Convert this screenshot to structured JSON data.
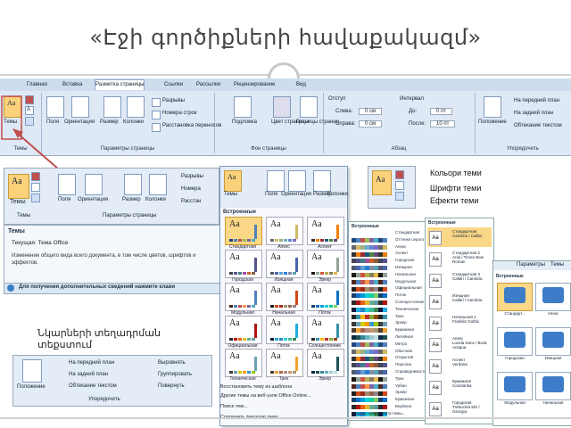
{
  "slide_title": "«Էջի գործիքների հավաքակազմ»",
  "ribbon": {
    "tabs": [
      "Главная",
      "Вставка",
      "Разметка страницы",
      "Ссылки",
      "Рассылки",
      "Рецензирование",
      "Вид"
    ],
    "groups": {
      "themes": {
        "label": "Темы",
        "button": "Темы"
      },
      "page_setup": {
        "label": "Параметры страницы",
        "buttons": [
          "Поля",
          "Ориентация",
          "Размер",
          "Колонки"
        ],
        "small": [
          "Разрывы",
          "Номера строк",
          "Расстановка переносов"
        ]
      },
      "page_bg": {
        "label": "Фон страницы",
        "buttons": [
          "Подложка",
          "Цвет страницы",
          "Границы страниц"
        ]
      },
      "paragraph": {
        "label": "Абзац",
        "indent": "Отступ",
        "interval": "Интервал",
        "left": "Слева:",
        "right": "Справа:",
        "before": "До:",
        "after": "После:",
        "left_val": "0 см",
        "right_val": "0 см",
        "before_val": "0 пт",
        "after_val": "10 пт"
      },
      "arrange": {
        "label": "Упорядочить",
        "items": [
          "Положение",
          "На передний план",
          "На задний план",
          "Обтекание текстом"
        ]
      }
    }
  },
  "ribbon2": {
    "buttons": [
      "Темы",
      "Поля",
      "Ориентация",
      "Размер",
      "Колонки"
    ],
    "small": [
      "Разрывы",
      "Номера",
      "Расстан"
    ],
    "group1": "Темы",
    "group2": "Параметры страницы"
  },
  "theme_panel": {
    "heading": "Темы",
    "current": "Текущая: Тема Office",
    "desc": "Изменение общего вида всего документа, в том числе цветов, шрифтов и эффектов.",
    "help": "Для получения дополнительных сведений нажмите клави"
  },
  "gallery": {
    "top_buttons": [
      "Темы",
      "Поля",
      "Ориентация",
      "Размер",
      "Колонки"
    ],
    "section": "Встроенные",
    "themes": [
      {
        "name": "Стандартная",
        "colors": [
          "#1f497d",
          "#4f81bd",
          "#c0504d",
          "#9bbb59",
          "#8064a2",
          "#4bacc6"
        ]
      },
      {
        "name": "Апекс",
        "colors": [
          "#69676d",
          "#ceb966",
          "#9cb084",
          "#6bb1c9",
          "#6585cf",
          "#7e6bc9"
        ]
      },
      {
        "name": "Аспект",
        "colors": [
          "#323232",
          "#f07f09",
          "#9f2936",
          "#1b587c",
          "#4e8542",
          "#604878"
        ]
      },
      {
        "name": "Городская",
        "colors": [
          "#424456",
          "#53548a",
          "#438086",
          "#a04da3",
          "#c4652d",
          "#8b5d3d"
        ]
      },
      {
        "name": "Изящная",
        "colors": [
          "#4e5b6f",
          "#4a66ac",
          "#629dd1",
          "#297fd5",
          "#7f8fa9",
          "#5aa2ae"
        ]
      },
      {
        "name": "Эркер",
        "colors": [
          "#1c1a10",
          "#93a299",
          "#cf543f",
          "#b5ae53",
          "#848058",
          "#e8b54d"
        ]
      },
      {
        "name": "Модульная",
        "colors": [
          "#4f271c",
          "#4f81bd",
          "#c0504d",
          "#f79646",
          "#8064a2",
          "#4bacc6"
        ]
      },
      {
        "name": "Начальная",
        "colors": [
          "#1f1f1f",
          "#d34817",
          "#9b2d1f",
          "#a28e6a",
          "#956251",
          "#918485"
        ]
      },
      {
        "name": "Поток",
        "colors": [
          "#17406d",
          "#0f6fc6",
          "#009dd9",
          "#0bd0d9",
          "#10cf9b",
          "#7cca62"
        ]
      },
      {
        "name": "Официальная",
        "colors": [
          "#2b2b2b",
          "#b01513",
          "#ea6312",
          "#e6b729",
          "#6aac90",
          "#5f9c9d"
        ]
      },
      {
        "name": "Поток",
        "colors": [
          "#0f1c3f",
          "#1cade4",
          "#2683c6",
          "#27ced7",
          "#42ba97",
          "#3e8853"
        ]
      },
      {
        "name": "Солнцестояние",
        "colors": [
          "#262626",
          "#3891a7",
          "#feb80a",
          "#c32d2e",
          "#84aa33",
          "#964305"
        ]
      },
      {
        "name": "Техническая",
        "colors": [
          "#3b3b3b",
          "#6ea0b0",
          "#cccc00",
          "#ff9900",
          "#3399cc",
          "#99cc00"
        ]
      },
      {
        "name": "Трек",
        "colors": [
          "#4e3b30",
          "#f0a22e",
          "#a5644e",
          "#b58b80",
          "#c3986d",
          "#a19574"
        ]
      },
      {
        "name": "Эркер",
        "colors": [
          "#0e2841",
          "#1e5155",
          "#36879a",
          "#65b1bf",
          "#99c9cf",
          "#bfdcdf"
        ]
      }
    ],
    "menu": [
      "Восстановить тему из шаблона",
      "Другие темы на веб-узле Office Online...",
      "Поиск тем...",
      "Сохранить текущую тему..."
    ]
  },
  "colors_panel": {
    "section": "Встроенные",
    "names": [
      "Стандартная",
      "Оттенки серого",
      "Апекс",
      "Аспект",
      "Городская",
      "Изящная",
      "Начальная",
      "Модульная",
      "Официальная",
      "Поток",
      "Солнцестояние",
      "Техническая",
      "Трек",
      "Эркер",
      "Бумажная",
      "Литейная",
      "Метро",
      "Обычная",
      "Открытая",
      "Персона",
      "Справедливость",
      "Трек",
      "Урбан",
      "Эркер",
      "Бумажная",
      "Вербена"
    ],
    "footer": "Создать новые цвета темы..."
  },
  "fonts_panel": {
    "section": "Встроенные",
    "items": [
      {
        "name": "Стандартная",
        "fonts": "Cambria / Calibri"
      },
      {
        "name": "Стандартная 2",
        "fonts": "Arial / Times New Roman"
      },
      {
        "name": "Стандартная 3",
        "fonts": "Calibri / Cambria"
      },
      {
        "name": "Изящная",
        "fonts": "Calibri / Cambria"
      },
      {
        "name": "Начальная 2",
        "fonts": "Franklin Gothic"
      },
      {
        "name": "Апекс",
        "fonts": "Lucida Sans / Book Antiqua"
      },
      {
        "name": "Аспект",
        "fonts": "Verdana"
      },
      {
        "name": "Бумажная",
        "fonts": "Constantia"
      },
      {
        "name": "Городская",
        "fonts": "Trebuchet MS / Georgia"
      }
    ]
  },
  "effects_panel": {
    "tabs": [
      "Параметры",
      "Темы"
    ],
    "section": "Встроенные",
    "items": [
      {
        "name": "Стандарт..."
      },
      {
        "name": "Апекс"
      },
      {
        "name": "Городская"
      },
      {
        "name": "Изящная"
      },
      {
        "name": "Модульная"
      },
      {
        "name": "Начальная"
      }
    ]
  },
  "right_labels": [
    "Кольори теми",
    "Шрифти теми",
    "Ефекти теми"
  ],
  "caption": "Նկարների տեղադրման տեքստում",
  "arrange_ribbon": {
    "label": "Упорядочить",
    "pos": "Положение",
    "items": [
      "На передний план",
      "На задний план",
      "Обтекание текстом"
    ],
    "right": [
      "Выровнять",
      "Группировать",
      "Повернуть"
    ]
  },
  "colors": {
    "accent": "#4f81bd",
    "arrow": "#c0504d",
    "selected": "#fbd17a"
  }
}
